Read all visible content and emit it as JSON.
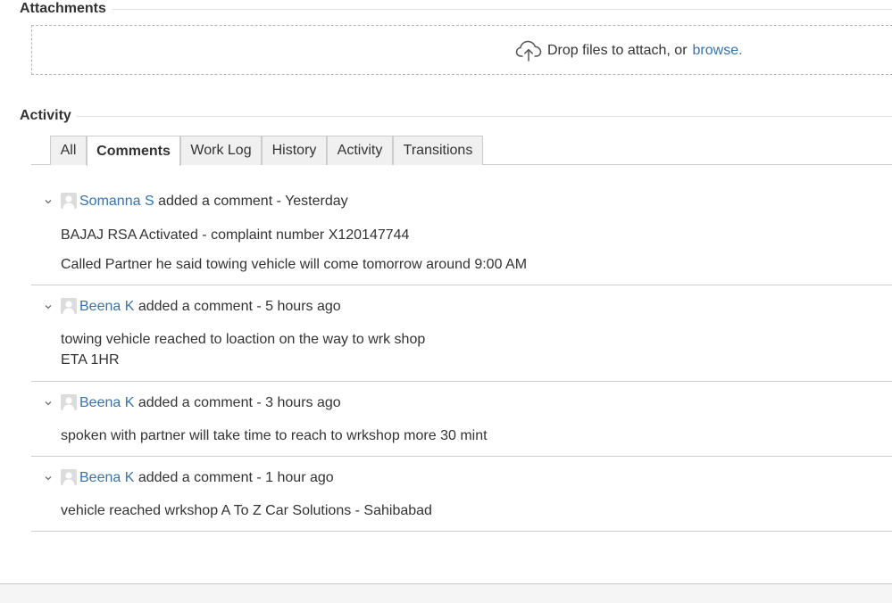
{
  "attachments": {
    "heading": "Attachments",
    "drop_text": "Drop files to attach, or",
    "browse_link": "browse.",
    "icon": "upload-cloud-icon"
  },
  "activity": {
    "heading": "Activity",
    "tabs": [
      {
        "label": "All",
        "active": false
      },
      {
        "label": "Comments",
        "active": true
      },
      {
        "label": "Work Log",
        "active": false
      },
      {
        "label": "History",
        "active": false
      },
      {
        "label": "Activity",
        "active": false
      },
      {
        "label": "Transitions",
        "active": false
      }
    ]
  },
  "comments": [
    {
      "user": "Somanna S",
      "action": "added a comment -",
      "time": "Yesterday",
      "lines": [
        "BAJAJ RSA Activated - complaint number X120147744",
        "Called Partner he said towing vehicle will come tomorrow around 9:00 AM"
      ]
    },
    {
      "user": "Beena K",
      "action": "added a comment -",
      "time": "5 hours ago",
      "lines": [
        "towing vehicle reached to loaction on the way to wrk shop",
        "ETA 1HR"
      ]
    },
    {
      "user": "Beena K",
      "action": "added a comment -",
      "time": "3 hours ago",
      "lines": [
        "spoken with partner will take time to reach to wrkshop more 30 mint"
      ]
    },
    {
      "user": "Beena K",
      "action": "added a comment -",
      "time": "1 hour ago",
      "lines": [
        "vehicle reached wrkshop A To Z Car Solutions - Sahibabad"
      ]
    }
  ],
  "colors": {
    "link": "#3572b0",
    "text": "#333333",
    "border": "#cccccc"
  }
}
